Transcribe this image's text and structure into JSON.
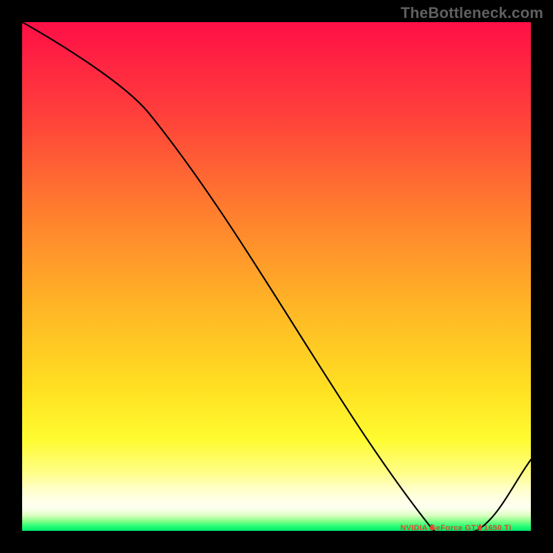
{
  "watermark": "TheBottleneck.com",
  "chart_data": {
    "type": "line",
    "title": "",
    "xlabel": "",
    "ylabel": "",
    "xlim": [
      0,
      100
    ],
    "ylim": [
      0,
      100
    ],
    "x": [
      0,
      25,
      80.5,
      90,
      100
    ],
    "values": [
      100,
      82,
      0.5,
      0.5,
      14
    ],
    "series": [
      {
        "name": "curve",
        "x": [
          0,
          25,
          80.5,
          90,
          100
        ],
        "values": [
          100,
          82,
          0.5,
          0.5,
          14
        ]
      }
    ],
    "annotation": {
      "text": "NVIDIA GeForce GTX 1650 Ti",
      "x_start": 80.5,
      "x_end": 90,
      "y": 0.6
    },
    "gradient_stops": [
      {
        "pos": 0,
        "color": "#ff0f47"
      },
      {
        "pos": 18,
        "color": "#ff3f3b"
      },
      {
        "pos": 36,
        "color": "#ff7a2f"
      },
      {
        "pos": 55,
        "color": "#ffb326"
      },
      {
        "pos": 72,
        "color": "#ffe022"
      },
      {
        "pos": 82,
        "color": "#fffb30"
      },
      {
        "pos": 88.5,
        "color": "#fffe85"
      },
      {
        "pos": 91.5,
        "color": "#ffffc4"
      },
      {
        "pos": 93.5,
        "color": "#ffffe2"
      },
      {
        "pos": 95,
        "color": "#fffff0"
      },
      {
        "pos": 96,
        "color": "#f5ffe2"
      },
      {
        "pos": 97,
        "color": "#d8ffc0"
      },
      {
        "pos": 98,
        "color": "#8bff8b"
      },
      {
        "pos": 99,
        "color": "#2eff77"
      },
      {
        "pos": 100,
        "color": "#00e86c"
      }
    ]
  }
}
